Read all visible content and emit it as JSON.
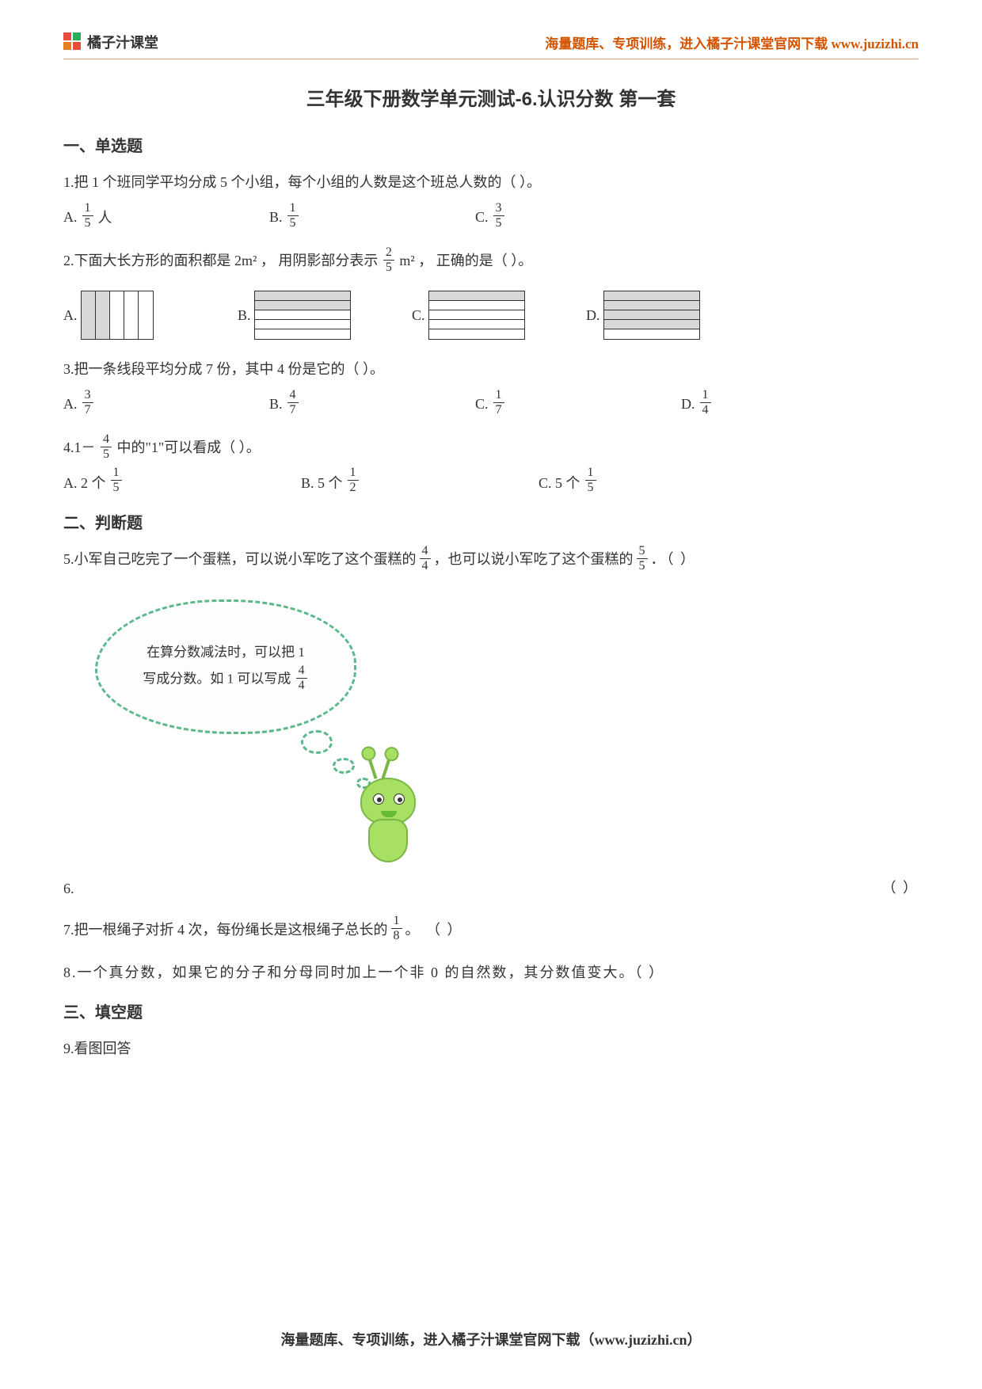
{
  "header": {
    "brand": "橘子汁课堂",
    "tagline": "海量题库、专项训练，进入橘子汁课堂官网下载 www.juzizhi.cn"
  },
  "title": "三年级下册数学单元测试-6.认识分数  第一套",
  "sections": {
    "s1": "一、单选题",
    "s2": "二、判断题",
    "s3": "三、填空题"
  },
  "q1": {
    "text": "1.把 1 个班同学平均分成 5 个小组，每个小组的人数是这个班总人数的（   ）。",
    "optA_label": "A.",
    "optA_num": "1",
    "optA_den": "5",
    "optA_suffix": "人",
    "optB_label": "B.",
    "optB_num": "1",
    "optB_den": "5",
    "optC_label": "C.",
    "optC_num": "3",
    "optC_den": "5"
  },
  "q2": {
    "pre": "2.下面大长方形的面积都是 2m²   ，  用阴影部分表示 ",
    "frac_num": "2",
    "frac_den": "5",
    "post": " m²   ，  正确的是（   ）。",
    "labels": {
      "a": "A.",
      "b": "B.",
      "c": "C.",
      "d": "D."
    }
  },
  "q3": {
    "text": "3.把一条线段平均分成 7 份，其中 4 份是它的（     ）。",
    "optA_label": "A.",
    "optA_num": "3",
    "optA_den": "7",
    "optB_label": "B.",
    "optB_num": "4",
    "optB_den": "7",
    "optC_label": "C.",
    "optC_num": "1",
    "optC_den": "7",
    "optD_label": "D.",
    "optD_num": "1",
    "optD_den": "4"
  },
  "q4": {
    "pre": "4.1－ ",
    "frac_num": "4",
    "frac_den": "5",
    "post": " 中的\"1\"可以看成（   ）。",
    "optA_label": "A. 2 个 ",
    "optA_num": "1",
    "optA_den": "5",
    "optB_label": "B. 5 个 ",
    "optB_num": "1",
    "optB_den": "2",
    "optC_label": "C. 5 个 ",
    "optC_num": "1",
    "optC_den": "5"
  },
  "q5": {
    "pre": "5.小军自己吃完了一个蛋糕，可以说小军吃了这个蛋糕的 ",
    "f1_num": "4",
    "f1_den": "4",
    "mid": "，也可以说小军吃了这个蛋糕的 ",
    "f2_num": "5",
    "f2_den": "5",
    "post": "．（   ）"
  },
  "q6": {
    "cloud_line1": "在算分数减法时，可以把 1",
    "cloud_line2_pre": "写成分数。如 1 可以写成",
    "cloud_frac_num": "4",
    "cloud_frac_den": "4",
    "num": "6.",
    "paren": "（        ）"
  },
  "q7": {
    "pre": "7.把一根绳子对折 4 次，每份绳长是这根绳子总长的 ",
    "frac_num": "1",
    "frac_den": "8",
    "post": " 。       （        ）"
  },
  "q8": {
    "text": "8.一个真分数，如果它的分子和分母同时加上一个非 0 的自然数，其分数值变大。（       ）"
  },
  "q9": {
    "text": "9.看图回答"
  },
  "footer": "海量题库、专项训练，进入橘子汁课堂官网下载（www.juzizhi.cn）"
}
